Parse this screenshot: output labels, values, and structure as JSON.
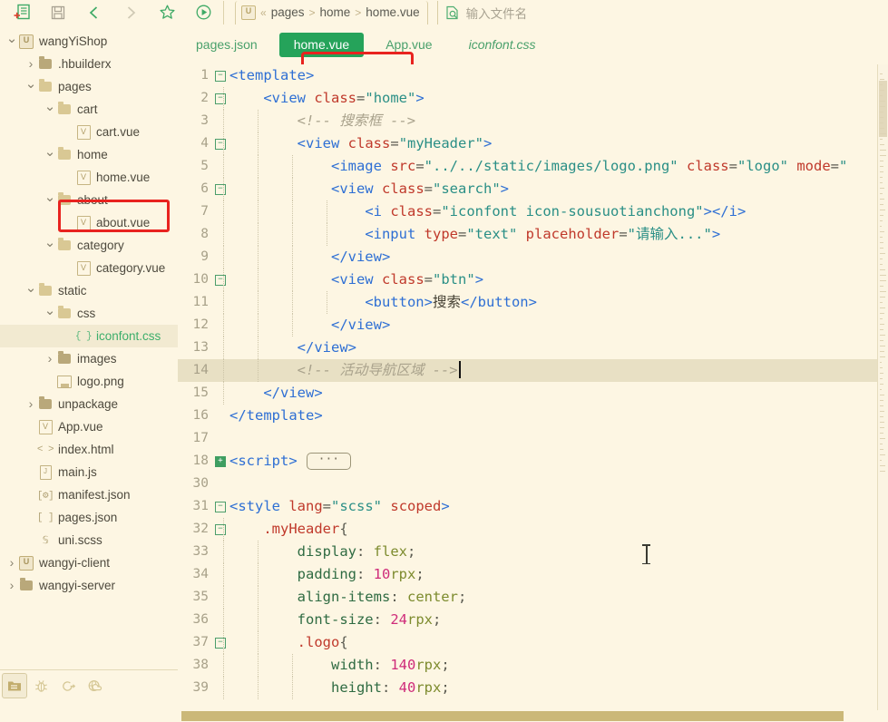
{
  "toolbar": {
    "buttons": [
      {
        "name": "new-file-icon",
        "label": "新建"
      },
      {
        "name": "save-icon",
        "label": "保存"
      },
      {
        "name": "back-arrow-icon",
        "label": "后退"
      },
      {
        "name": "forward-arrow-icon",
        "label": "前进"
      },
      {
        "name": "star-icon",
        "label": "收藏"
      },
      {
        "name": "run-icon",
        "label": "运行"
      }
    ],
    "breadcrumb": {
      "project_badge": "U",
      "prefix": "«",
      "segments": [
        "pages",
        "home",
        "home.vue"
      ],
      "separator": ">"
    },
    "file_search": {
      "placeholder": "输入文件名",
      "value": ""
    }
  },
  "sidebar": {
    "items": [
      {
        "label": "wangYiShop",
        "depth": 0,
        "arrow": "down",
        "icon": "project-u-icon"
      },
      {
        "label": ".hbuilderx",
        "depth": 1,
        "arrow": "right",
        "icon": "folder-dark-icon"
      },
      {
        "label": "pages",
        "depth": 1,
        "arrow": "down",
        "icon": "folder-icon"
      },
      {
        "label": "cart",
        "depth": 2,
        "arrow": "down",
        "icon": "folder-icon"
      },
      {
        "label": "cart.vue",
        "depth": 3,
        "arrow": "none",
        "icon": "vue-file-icon"
      },
      {
        "label": "home",
        "depth": 2,
        "arrow": "down",
        "icon": "folder-icon"
      },
      {
        "label": "home.vue",
        "depth": 3,
        "arrow": "none",
        "icon": "vue-file-icon",
        "annotated": true
      },
      {
        "label": "about",
        "depth": 2,
        "arrow": "down",
        "icon": "folder-icon"
      },
      {
        "label": "about.vue",
        "depth": 3,
        "arrow": "none",
        "icon": "vue-file-icon"
      },
      {
        "label": "category",
        "depth": 2,
        "arrow": "down",
        "icon": "folder-icon"
      },
      {
        "label": "category.vue",
        "depth": 3,
        "arrow": "none",
        "icon": "vue-file-icon"
      },
      {
        "label": "static",
        "depth": 1,
        "arrow": "down",
        "icon": "folder-icon"
      },
      {
        "label": "css",
        "depth": 2,
        "arrow": "down",
        "icon": "folder-icon"
      },
      {
        "label": "iconfont.css",
        "depth": 3,
        "arrow": "none",
        "icon": "css-brace-icon",
        "selected": true,
        "green": true
      },
      {
        "label": "images",
        "depth": 2,
        "arrow": "right",
        "icon": "folder-dark-icon"
      },
      {
        "label": "logo.png",
        "depth": 2,
        "arrow": "none",
        "icon": "image-file-icon"
      },
      {
        "label": "unpackage",
        "depth": 1,
        "arrow": "right",
        "icon": "folder-dark-icon"
      },
      {
        "label": "App.vue",
        "depth": 1,
        "arrow": "none",
        "icon": "vue-file-icon"
      },
      {
        "label": "index.html",
        "depth": 1,
        "arrow": "none",
        "icon": "html-file-icon"
      },
      {
        "label": "main.js",
        "depth": 1,
        "arrow": "none",
        "icon": "js-file-icon"
      },
      {
        "label": "manifest.json",
        "depth": 1,
        "arrow": "none",
        "icon": "manifest-file-icon"
      },
      {
        "label": "pages.json",
        "depth": 1,
        "arrow": "none",
        "icon": "json-file-icon"
      },
      {
        "label": "uni.scss",
        "depth": 1,
        "arrow": "none",
        "icon": "scss-file-icon"
      },
      {
        "label": "wangyi-client",
        "depth": 0,
        "arrow": "right",
        "icon": "project-u-icon"
      },
      {
        "label": "wangyi-server",
        "depth": 0,
        "arrow": "right",
        "icon": "folder-dark-icon"
      }
    ],
    "bottom_bar": [
      {
        "name": "explorer-icon",
        "label": "项目管理器"
      },
      {
        "name": "bug-icon",
        "label": "调试"
      },
      {
        "name": "terminal-icon",
        "label": "终端"
      },
      {
        "name": "browser-icon",
        "label": "浏览器"
      }
    ]
  },
  "editor": {
    "tabs": [
      {
        "label": "pages.json",
        "active": false,
        "italic": false
      },
      {
        "label": "home.vue",
        "active": true,
        "italic": false,
        "annotated": true
      },
      {
        "label": "App.vue",
        "active": false,
        "italic": false
      },
      {
        "label": "iconfont.css",
        "active": false,
        "italic": true
      }
    ],
    "current_line": 14,
    "lines": [
      {
        "n": "1",
        "fold": "minus",
        "indent": 0
      },
      {
        "n": "2",
        "fold": "minus",
        "indent": 1
      },
      {
        "n": "3",
        "fold": "",
        "indent": 2
      },
      {
        "n": "4",
        "fold": "minus",
        "indent": 2
      },
      {
        "n": "5",
        "fold": "",
        "indent": 3
      },
      {
        "n": "6",
        "fold": "minus",
        "indent": 3
      },
      {
        "n": "7",
        "fold": "",
        "indent": 4
      },
      {
        "n": "8",
        "fold": "",
        "indent": 4
      },
      {
        "n": "9",
        "fold": "",
        "indent": 3
      },
      {
        "n": "10",
        "fold": "minus",
        "indent": 3
      },
      {
        "n": "11",
        "fold": "",
        "indent": 4
      },
      {
        "n": "12",
        "fold": "",
        "indent": 3
      },
      {
        "n": "13",
        "fold": "",
        "indent": 2
      },
      {
        "n": "14",
        "fold": "",
        "indent": 2
      },
      {
        "n": "15",
        "fold": "",
        "indent": 1
      },
      {
        "n": "16",
        "fold": "",
        "indent": 0
      },
      {
        "n": "17",
        "fold": "",
        "indent": 0
      },
      {
        "n": "18",
        "fold": "plus",
        "indent": 0
      },
      {
        "n": "30",
        "fold": "",
        "indent": 0
      },
      {
        "n": "31",
        "fold": "minus",
        "indent": 0
      },
      {
        "n": "32",
        "fold": "minus",
        "indent": 1
      },
      {
        "n": "33",
        "fold": "",
        "indent": 2
      },
      {
        "n": "34",
        "fold": "",
        "indent": 2
      },
      {
        "n": "35",
        "fold": "",
        "indent": 2
      },
      {
        "n": "36",
        "fold": "",
        "indent": 2
      },
      {
        "n": "37",
        "fold": "minus",
        "indent": 2
      },
      {
        "n": "38",
        "fold": "",
        "indent": 3
      },
      {
        "n": "39",
        "fold": "",
        "indent": 3
      }
    ],
    "source": {
      "l1": "<template>",
      "l2": "    <view class=\"home\">",
      "l3": "        <!-- 搜索框 -->",
      "l4": "        <view class=\"myHeader\">",
      "l5": "            <image src=\"../../static/images/logo.png\" class=\"logo\" mode=\"",
      "l6": "            <view class=\"search\">",
      "l7": "                <i class=\"iconfont icon-sousuotianchong\"></i>",
      "l8": "                <input type=\"text\" placeholder=\"请输入...\">",
      "l9": "            </view>",
      "l10": "            <view class=\"btn\">",
      "l11": "                <button>搜索</button>",
      "l12": "            </view>",
      "l13": "        </view>",
      "l14": "        <!-- 活动导航区域 -->",
      "l15": "    </view>",
      "l16": "</template>",
      "l17": "",
      "l18": "<script>",
      "l18_collapsed": "···",
      "l30": "",
      "l31": "<style lang=\"scss\" scoped>",
      "l32": "    .myHeader{",
      "l33": "        display: flex;",
      "l34": "        padding: 10rpx;",
      "l35": "        align-items: center;",
      "l36": "        font-size: 24rpx;",
      "l37": "        .logo{",
      "l38": "            width: 140rpx;",
      "l39": "            height: 40rpx;"
    }
  },
  "colors": {
    "background": "#fdf6e3",
    "accent_green": "#25a35a",
    "annotation_red": "#e8231f",
    "current_line": "#e8e0c4",
    "scrollbar": "#cbb878"
  }
}
